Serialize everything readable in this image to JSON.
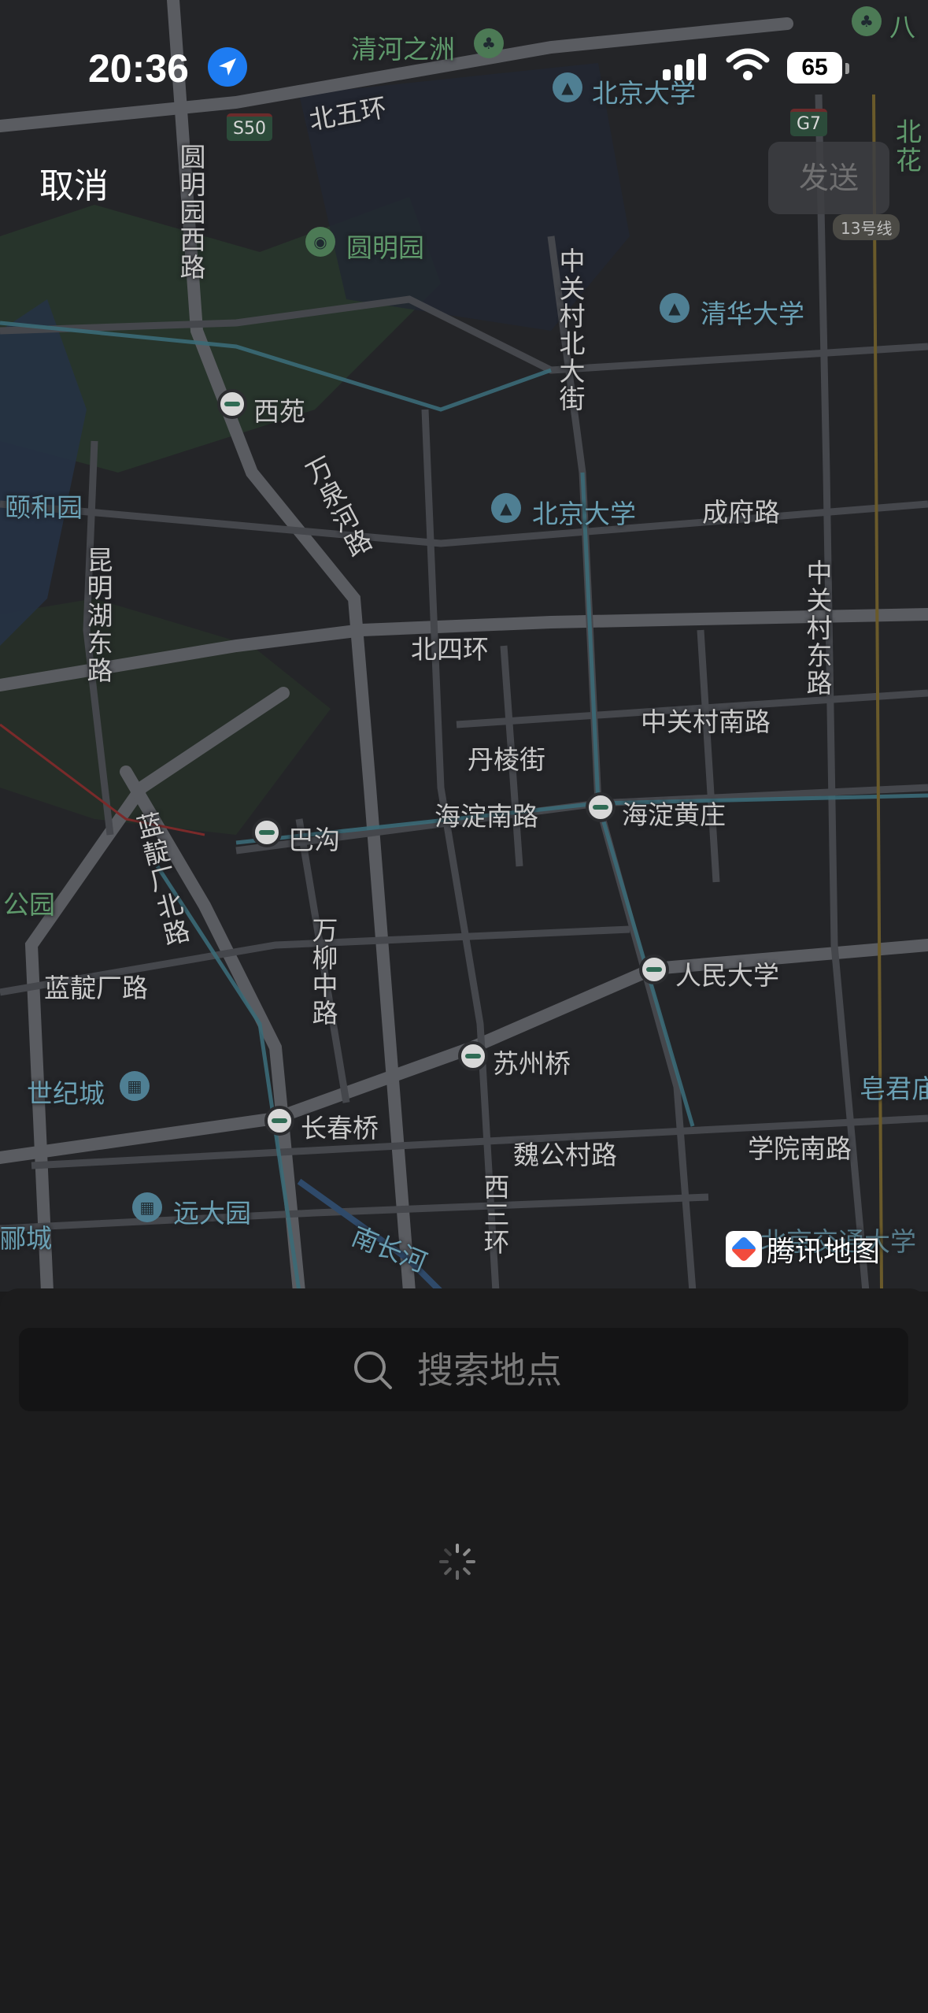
{
  "status_bar": {
    "time": "20:36",
    "battery": "65"
  },
  "header": {
    "cancel_label": "取消",
    "send_label": "发送"
  },
  "map": {
    "roads": {
      "bei_wu_huan": "北五环",
      "yuanmingyuan_xilu": "圆明园西路",
      "zhongguancun_beidajie": "中关村北大街",
      "wanquanhe_lu": "万泉河路",
      "chengfu_lu": "成府路",
      "kunminghu_donglu": "昆明湖东路",
      "bei_si_huan": "北四环",
      "zhongguancun_donglu": "中关村东路",
      "zhongguancun_nanlu": "中关村南路",
      "danleng_jie": "丹棱街",
      "haidian_nanlu": "海淀南路",
      "landianchang_beilu": "蓝靛厂北路",
      "wanliu_zhonglu": "万柳中路",
      "landianchang_lu": "蓝靛厂路",
      "weigongcun_lu": "魏公村路",
      "xueyuan_nanlu": "学院南路",
      "xi_san_huan": "西三环",
      "nanchang_he": "南长河"
    },
    "places": {
      "qinghe_zhizhou": "清河之洲",
      "peking_univ_top": "北京大学",
      "yuanmingyuan": "圆明园",
      "tsinghua": "清华大学",
      "peking_univ": "北京大学",
      "yiheyuan": "颐和园",
      "park_left": "公园",
      "shijicheng": "世纪城",
      "yuandayuan": "远大园",
      "left_city": "郦城",
      "huangjunting": "皂君庙",
      "beijing_jiaotong": "北京交通大学",
      "top_right_1": "八",
      "top_right_2": "北\n花"
    },
    "stations": {
      "xiyuan": "西苑",
      "bagou": "巴沟",
      "haidian_huangzhuang": "海淀黄庄",
      "renmin_daxue": "人民大学",
      "suzhou_qiao": "苏州桥",
      "changchun_qiao": "长春桥"
    },
    "shields": {
      "s50": "S50",
      "g7": "G7",
      "line13": "13号线"
    },
    "logo_text": "腾讯地图"
  },
  "search": {
    "placeholder": "搜索地点",
    "value": ""
  },
  "icons": {
    "location": "location-arrow-icon",
    "search": "search-icon",
    "spinner": "loading-spinner-icon"
  },
  "colors": {
    "location_blue": "#1e7cf2",
    "background": "#1b1b1c"
  }
}
